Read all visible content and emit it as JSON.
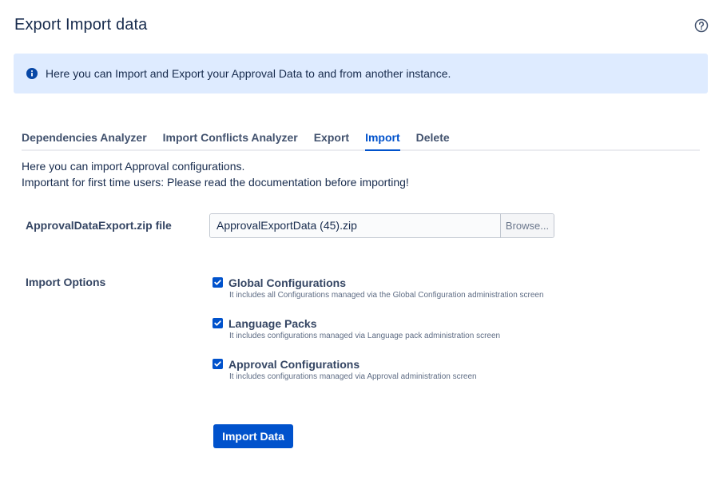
{
  "page": {
    "title": "Export Import data",
    "help_icon": "question-circle-icon"
  },
  "banner": {
    "icon": "info-icon",
    "text": "Here you can Import and Export your Approval Data to and from another instance."
  },
  "tabs": [
    {
      "label": "Dependencies Analyzer",
      "active": false
    },
    {
      "label": "Import Conflicts Analyzer",
      "active": false
    },
    {
      "label": "Export",
      "active": false
    },
    {
      "label": "Import",
      "active": true
    },
    {
      "label": "Delete",
      "active": false
    }
  ],
  "intro": {
    "line1": "Here you can import Approval configurations.",
    "line2": "Important for first time users: Please read the documentation before importing!"
  },
  "file_field": {
    "label": "ApprovalDataExport.zip file",
    "value": "ApprovalExportData (45).zip",
    "browse_label": "Browse..."
  },
  "import_options": {
    "label": "Import Options",
    "options": [
      {
        "label": "Global Configurations",
        "description": "It includes all Configurations managed via the Global Configuration administration screen",
        "checked": true
      },
      {
        "label": "Language Packs",
        "description": "It includes configurations managed via Language pack administration screen",
        "checked": true
      },
      {
        "label": "Approval Configurations",
        "description": "It includes configurations managed via Approval administration screen",
        "checked": true
      }
    ]
  },
  "actions": {
    "import_label": "Import Data"
  },
  "colors": {
    "primary": "#0052cc",
    "banner_bg": "#deebff",
    "text": "#172b4d"
  }
}
